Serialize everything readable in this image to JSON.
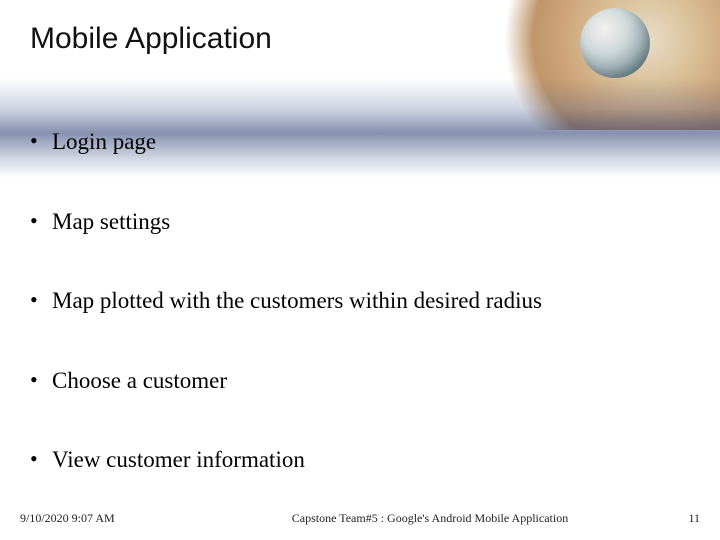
{
  "slide": {
    "title": "Mobile Application",
    "bullets": [
      "Login page",
      "Map settings",
      "Map plotted with the customers within desired radius",
      "Choose a customer",
      "View customer information"
    ]
  },
  "footer": {
    "datetime": "9/10/2020 9:07 AM",
    "center": "Capstone Team#5 : Google's Android Mobile Application",
    "page": "11"
  }
}
